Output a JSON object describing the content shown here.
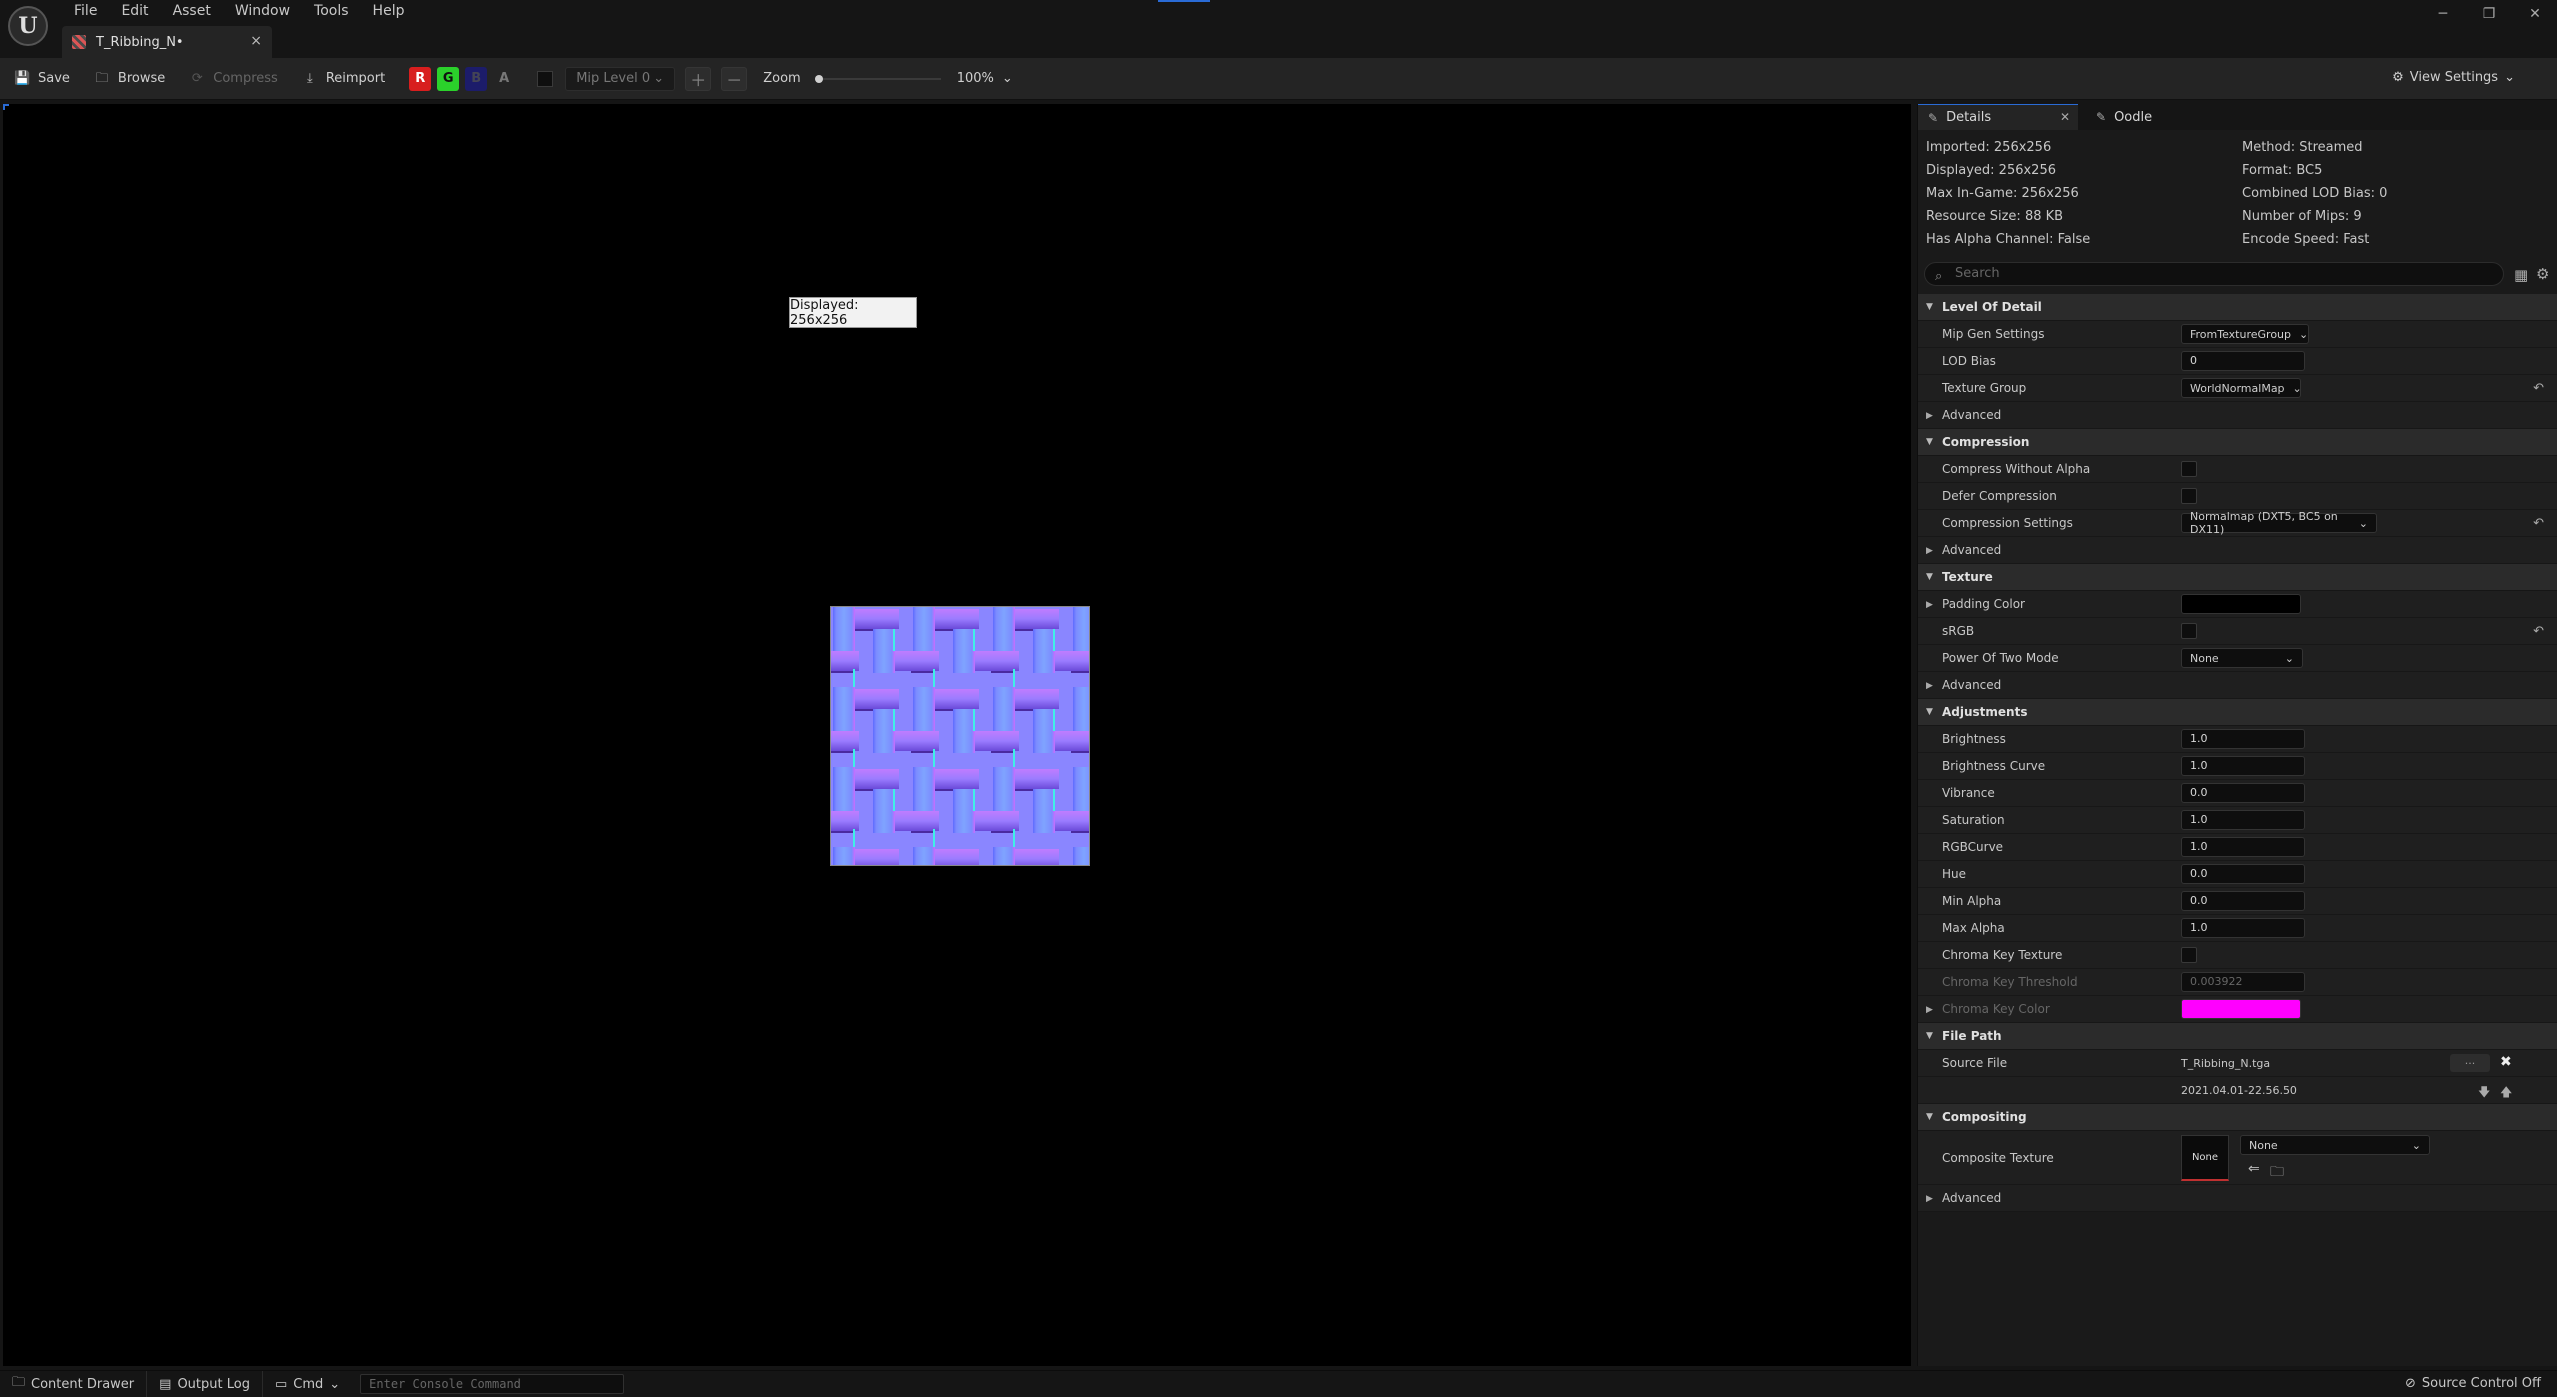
{
  "app": {
    "logo_text": "U",
    "menu": [
      "File",
      "Edit",
      "Asset",
      "Window",
      "Tools",
      "Help"
    ],
    "window_controls": {
      "minimize": "─",
      "restore": "❐",
      "close": "✕"
    },
    "tab_title": "T_Ribbing_N•",
    "tab_close": "×"
  },
  "toolbar": {
    "save": "Save",
    "browse": "Browse",
    "compress": "Compress",
    "reimport": "Reimport",
    "channels": {
      "r": "R",
      "g": "G",
      "b": "B",
      "a": "A"
    },
    "mip_level": "Mip Level 0",
    "zoom_label": "Zoom",
    "zoom_value": "100%",
    "view_settings": "View Settings"
  },
  "viewport": {
    "tooltip": "Displayed: 256x256"
  },
  "details": {
    "tab_details": "Details",
    "tab_oodle": "Oodle",
    "info_left": [
      "Imported: 256x256",
      "Displayed: 256x256",
      "Max In-Game: 256x256",
      "Resource Size: 88 KB",
      "Has Alpha Channel: False"
    ],
    "info_right": [
      "Method: Streamed",
      "Format: BC5",
      "Combined LOD Bias: 0",
      "Number of Mips: 9",
      "Encode Speed: Fast"
    ],
    "search_placeholder": "Search",
    "lod": {
      "title": "Level Of Detail",
      "mip_gen_label": "Mip Gen Settings",
      "mip_gen_value": "FromTextureGroup",
      "lod_bias_label": "LOD Bias",
      "lod_bias_value": "0",
      "texture_group_label": "Texture Group",
      "texture_group_value": "WorldNormalMap",
      "advanced": "Advanced"
    },
    "compression": {
      "title": "Compression",
      "cwa_label": "Compress Without Alpha",
      "defer_label": "Defer Compression",
      "settings_label": "Compression Settings",
      "settings_value": "Normalmap (DXT5, BC5 on DX11)",
      "advanced": "Advanced"
    },
    "texture": {
      "title": "Texture",
      "padding_label": "Padding Color",
      "srgb_label": "sRGB",
      "pot_label": "Power Of Two Mode",
      "pot_value": "None",
      "advanced": "Advanced"
    },
    "adjustments": {
      "title": "Adjustments",
      "rows": [
        {
          "label": "Brightness",
          "value": "1.0"
        },
        {
          "label": "Brightness Curve",
          "value": "1.0"
        },
        {
          "label": "Vibrance",
          "value": "0.0"
        },
        {
          "label": "Saturation",
          "value": "1.0"
        },
        {
          "label": "RGBCurve",
          "value": "1.0"
        },
        {
          "label": "Hue",
          "value": "0.0"
        },
        {
          "label": "Min Alpha",
          "value": "0.0"
        },
        {
          "label": "Max Alpha",
          "value": "1.0"
        }
      ],
      "chroma_tex_label": "Chroma Key Texture",
      "chroma_thresh_label": "Chroma Key Threshold",
      "chroma_thresh_value": "0.003922",
      "chroma_color_label": "Chroma Key Color"
    },
    "file_path": {
      "title": "File Path",
      "source_label": "Source File",
      "source_value": "T_Ribbing_N.tga",
      "browse_dots": "...",
      "timestamp": "2021.04.01-22.56.50"
    },
    "compositing": {
      "title": "Compositing",
      "composite_label": "Composite Texture",
      "thumb_text": "None",
      "combo_value": "None",
      "advanced": "Advanced"
    }
  },
  "statusbar": {
    "content_drawer": "Content Drawer",
    "output_log": "Output Log",
    "cmd": "Cmd",
    "console_placeholder": "Enter Console Command",
    "source_control": "Source Control Off"
  },
  "colors": {
    "accent": "#2a6bd6",
    "padding_color": "#000000",
    "chroma_key_color": "#ff00ff"
  }
}
